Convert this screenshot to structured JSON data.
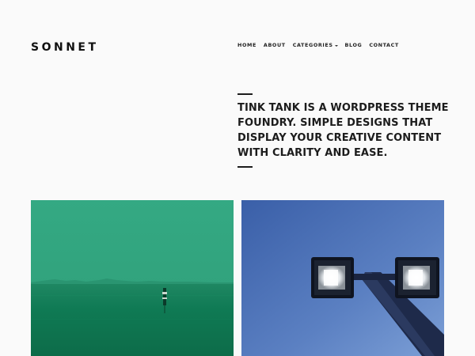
{
  "site": {
    "logo": "SONNET"
  },
  "nav": {
    "items": [
      {
        "label": "HOME"
      },
      {
        "label": "ABOUT"
      },
      {
        "label": "CATEGORIES",
        "has_dropdown": true
      },
      {
        "label": "BLOG"
      },
      {
        "label": "CONTACT"
      }
    ]
  },
  "intro": {
    "headline": "TINK TANK IS A WORDPRESS THEME FOUNDRY. SIMPLE DESIGNS THAT DISPLAY YOUR CREATIVE CONTENT WITH CLARITY AND EASE."
  },
  "posts": [
    {
      "image": "green-sea-buoy",
      "tint": "#2ea57c"
    },
    {
      "image": "street-lamp-blue-sky",
      "tint": "#4f73b5"
    }
  ],
  "colors": {
    "background": "#fafafa",
    "text": "#1c1c1c"
  }
}
